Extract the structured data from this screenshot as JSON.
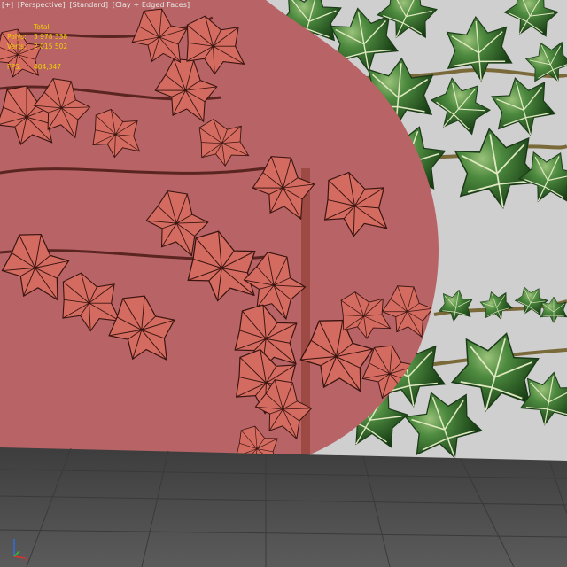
{
  "viewport_labels": {
    "plus": "[+]",
    "view": "[Perspective]",
    "shading": "[Standard]",
    "display": "[Clay + Edged Faces]"
  },
  "stats": {
    "total_label": "Total",
    "polys_label": "Polys:",
    "polys_value": "3 978 338",
    "verts_label": "Verts:",
    "verts_value": "2 015 502",
    "fps_label": "FPS:",
    "fps_value": "404,347"
  },
  "colors": {
    "stats_text": "#f0d000",
    "clay_overlay": "#b86466",
    "leaf_green": "#2f6a2a",
    "background": "#cfcfcf",
    "floor": "#4a4a4a"
  },
  "gizmo": {
    "axes": [
      "x",
      "y",
      "z"
    ]
  }
}
